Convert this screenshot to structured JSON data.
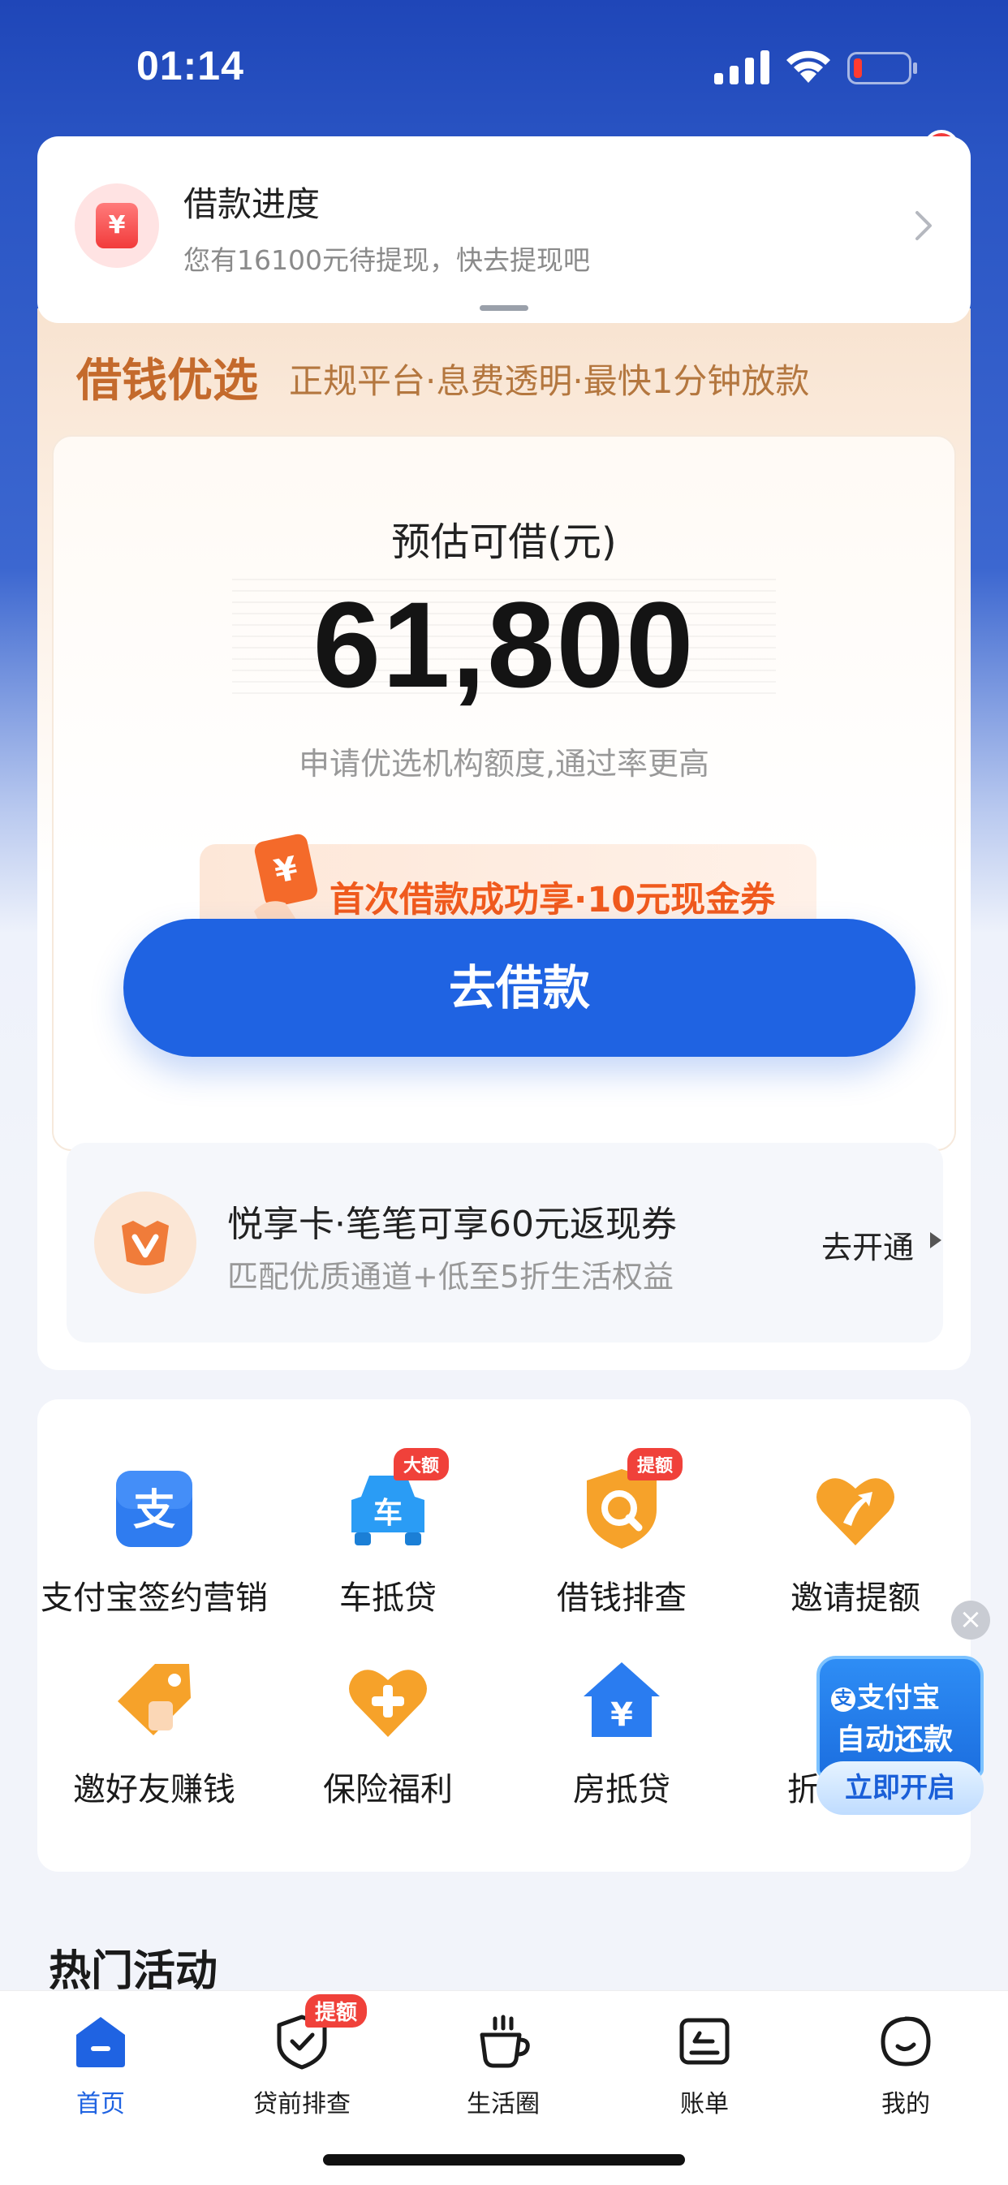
{
  "status_bar": {
    "time": "01:14"
  },
  "notice": {
    "title": "借款进度",
    "subtitle": "您有16100元待提现，快去提现吧",
    "icon_glyph": "¥"
  },
  "loan": {
    "brand": "借钱优选",
    "tagline": "正规平台·息费透明·最快1分钟放款",
    "estimate_label": "预估可借(元)",
    "amount": "61,800",
    "hint": "申请优选机构额度,通过率更高",
    "coupon_text": "首次借款成功享·10元现金券",
    "coupon_icon_glyph": "¥",
    "borrow_button": "去借款"
  },
  "vip": {
    "title": "悦享卡·笔笔可享60元返现券",
    "subtitle": "匹配优质通道+低至5折生活权益",
    "action": "去开通"
  },
  "services": [
    {
      "label": "支付宝签约营销",
      "icon": "alipay-icon",
      "glyph": "支"
    },
    {
      "label": "车抵贷",
      "icon": "car-icon",
      "glyph": "车",
      "tag": "大额"
    },
    {
      "label": "借钱排查",
      "icon": "search-shield-icon",
      "tag": "提额"
    },
    {
      "label": "邀请提额",
      "icon": "heart-arrow-icon"
    },
    {
      "label": "邀好友赚钱",
      "icon": "tag-icon"
    },
    {
      "label": "保险福利",
      "icon": "heart-plus-icon"
    },
    {
      "label": "房抵贷",
      "icon": "house-icon",
      "glyph": "¥"
    },
    {
      "label": "折",
      "icon": "discount-icon"
    }
  ],
  "promo": {
    "line1": "支付宝",
    "line2": "自动还款",
    "button": "立即开启",
    "close": "×"
  },
  "hot_section_title": "热门活动",
  "tabbar": {
    "items": [
      {
        "label": "首页",
        "icon": "home-icon",
        "active": true
      },
      {
        "label": "贷前排查",
        "icon": "shield-check-icon",
        "tag": "提额"
      },
      {
        "label": "生活圈",
        "icon": "coffee-cup-icon"
      },
      {
        "label": "账单",
        "icon": "bill-icon"
      },
      {
        "label": "我的",
        "icon": "profile-icon"
      }
    ]
  },
  "colors": {
    "primary_blue": "#1f63e2",
    "brand_orange": "#c46a2c",
    "coupon_orange": "#f05a1d",
    "tag_red": "#f0413a"
  }
}
